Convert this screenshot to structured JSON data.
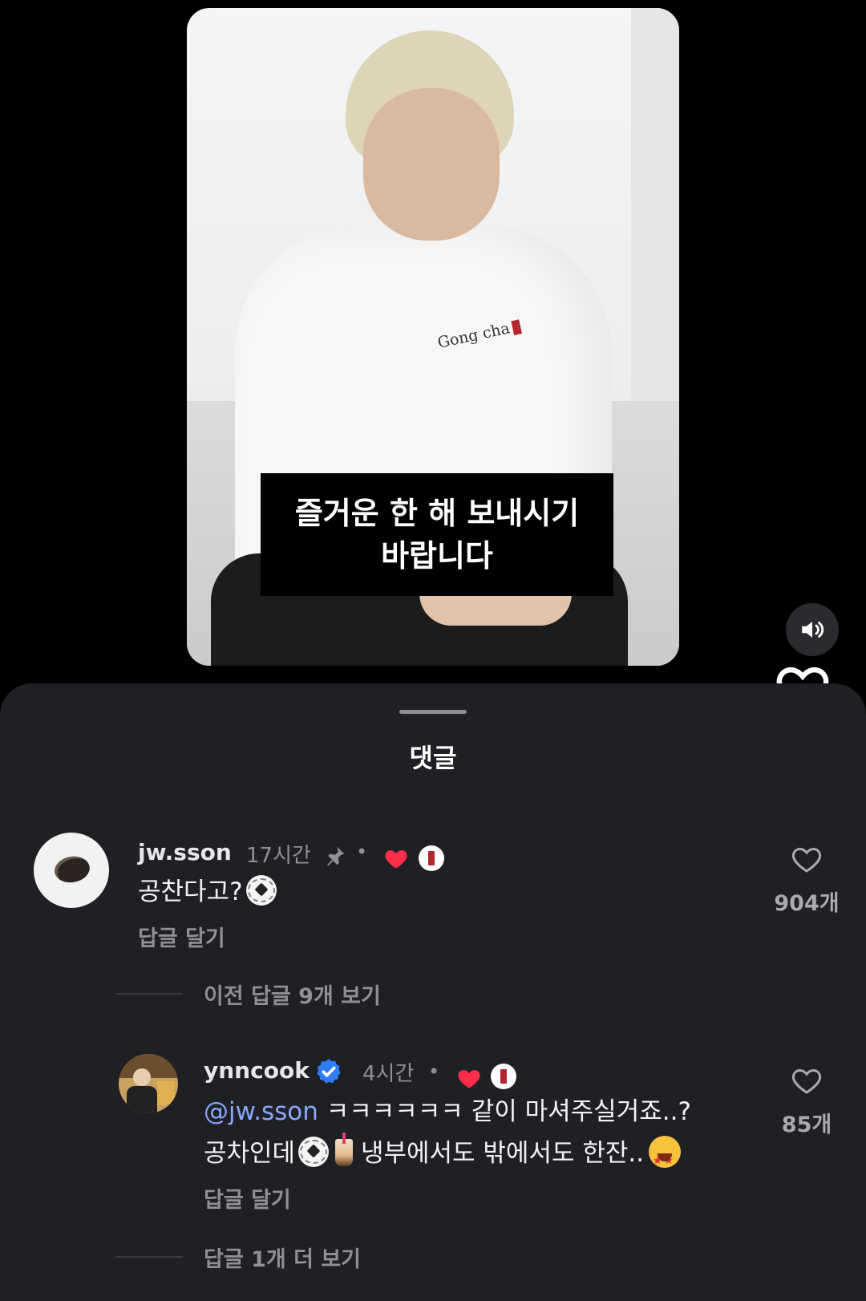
{
  "video": {
    "caption_line1": "즐거운 한 해 보내시기",
    "caption_line2": "바랍니다",
    "brand_tag": "Gong cha"
  },
  "sheet": {
    "title": "댓글"
  },
  "comments": [
    {
      "username": "jw.sson",
      "time": "17시간",
      "pinned": true,
      "text": "공찬다고?",
      "emoji": [
        "soccer-ball"
      ],
      "reply_label": "답글 달기",
      "like_count": "904개",
      "view_replies": "이전 답글 9개 보기"
    },
    {
      "username": "ynncook",
      "verified": true,
      "time": "4시간",
      "mention": "@jw.sson",
      "text_line1": " ㅋㅋㅋㅋㅋㅋ 같이 마셔주실거죠..?",
      "text_line2_a": "공차인데",
      "text_line2_b": " 냉부에서도 밖에서도 한잔..",
      "emoji": [
        "soccer-ball",
        "bubble-tea",
        "star-struck"
      ],
      "reply_label": "답글 달기",
      "like_count": "85개",
      "view_more": "답글 1개 더 보기"
    }
  ],
  "colors": {
    "sheet_bg": "#1f2024",
    "like_red": "#ff2d4a",
    "verified_blue": "#2f7dfa",
    "mention_blue": "#8aa6ff",
    "brand_red": "#b3262e"
  },
  "icons": [
    "volume-icon",
    "heart-outline-icon",
    "pin-icon",
    "heart-filled-icon",
    "verified-badge-icon",
    "brand-badge-icon"
  ]
}
